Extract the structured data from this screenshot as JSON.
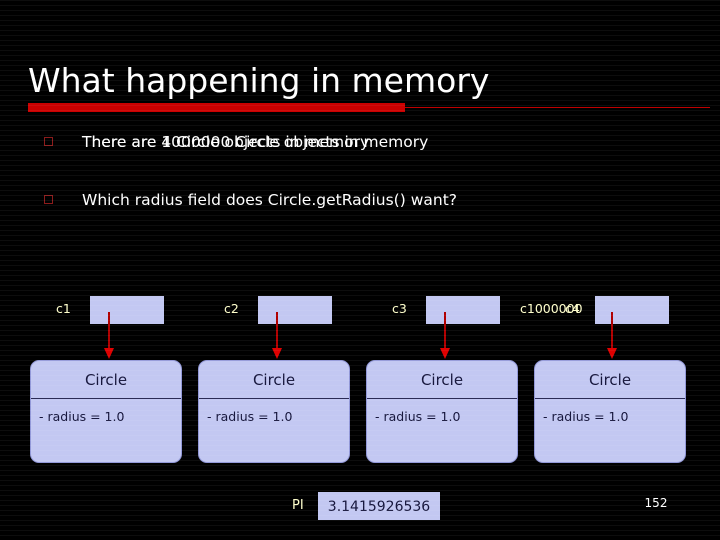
{
  "slide": {
    "title": "What happening in memory",
    "page_number": "152",
    "background_color": "#000000",
    "accent_color": "#cc0000",
    "box_fill_color": "#c3c8f2",
    "label_color": "#ffffcc",
    "arrow_color": "#cc0000"
  },
  "bullets": [
    {
      "marker": "square-outline-bullet",
      "overlapping_layers": [
        "There are 4 Circle objects in memory",
        "There are 1000000 Circle objects in memory"
      ]
    },
    {
      "marker": "square-outline-bullet",
      "text": "Which radius field does Circle.getRadius() want?"
    }
  ],
  "references": [
    {
      "label": "c1",
      "label_overlay": ""
    },
    {
      "label": "c2",
      "label_overlay": ""
    },
    {
      "label": "c3",
      "label_overlay": ""
    },
    {
      "label": "c1000000",
      "label_overlay": "c4"
    }
  ],
  "objects": [
    {
      "class_name": "Circle",
      "field": "- radius = 1.0"
    },
    {
      "class_name": "Circle",
      "field": "- radius = 1.0"
    },
    {
      "class_name": "Circle",
      "field": "- radius = 1.0"
    },
    {
      "class_name": "Circle",
      "field": "- radius = 1.0"
    }
  ],
  "static_field": {
    "label": "PI",
    "value": "3.1415926536"
  }
}
